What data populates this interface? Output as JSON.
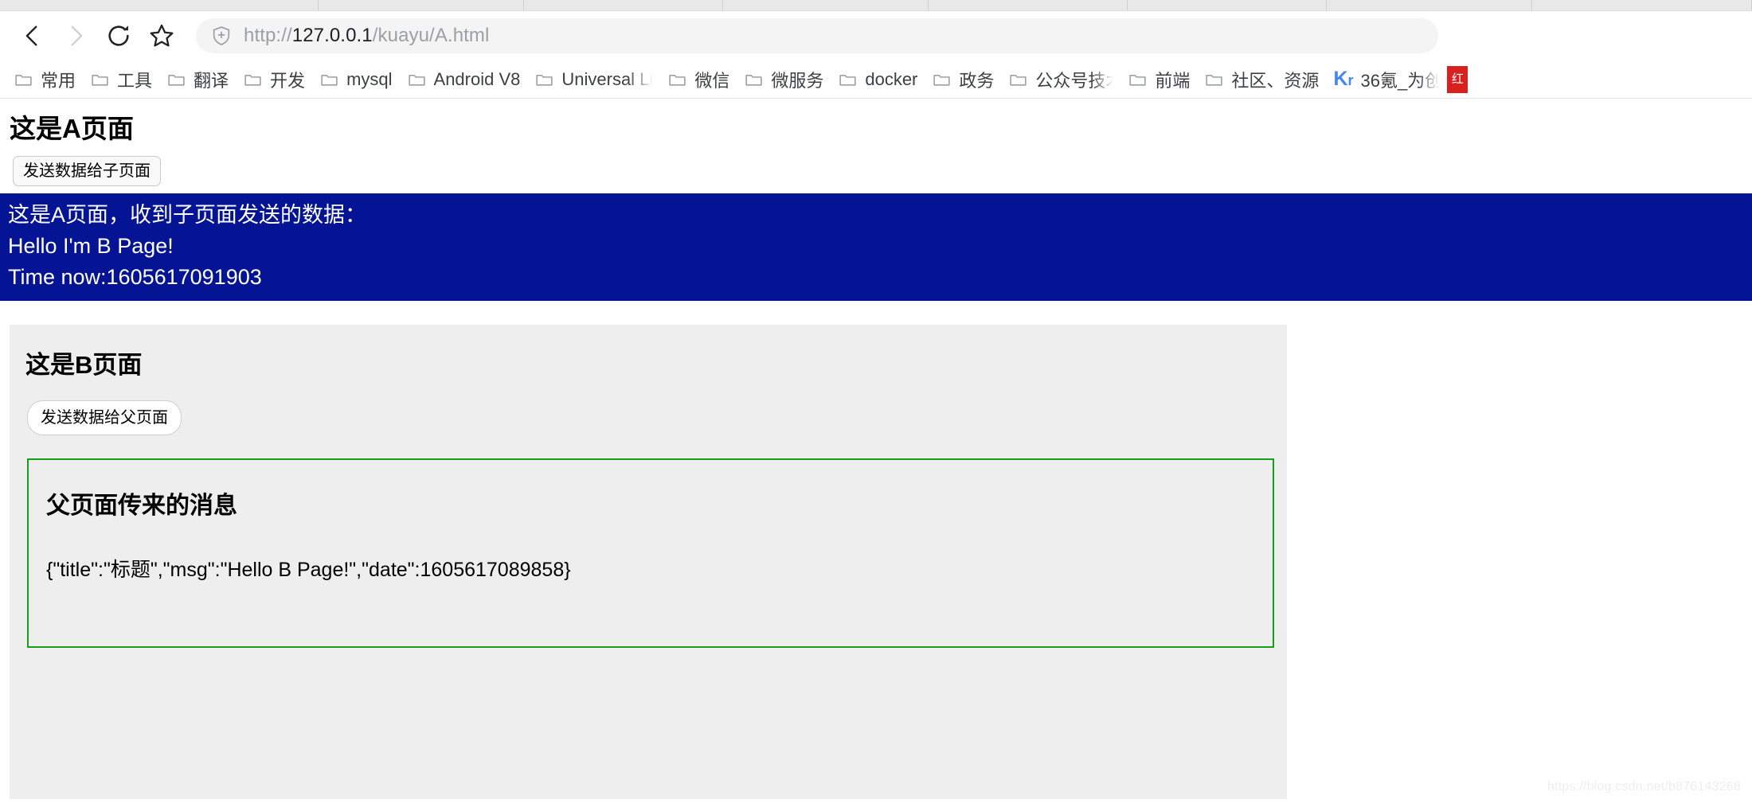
{
  "browser": {
    "nav": {
      "back_label": "Back",
      "forward_label": "Forward",
      "reload_label": "Reload",
      "bookmark_label": "Bookmark this page"
    },
    "omnibox": {
      "security_icon": "shield-plus-icon",
      "url_scheme": "http://",
      "url_host": "127.0.0.1",
      "url_path": "/kuayu/A.html",
      "url_full": "http://127.0.0.1/kuayu/A.html"
    },
    "bookmarks": [
      {
        "label": "常用",
        "icon": "folder-icon",
        "truncated": false
      },
      {
        "label": "工具",
        "icon": "folder-icon",
        "truncated": false
      },
      {
        "label": "翻译",
        "icon": "folder-icon",
        "truncated": false
      },
      {
        "label": "开发",
        "icon": "folder-icon",
        "truncated": false
      },
      {
        "label": "mysql",
        "icon": "folder-icon",
        "truncated": false
      },
      {
        "label": "Android V8",
        "icon": "folder-icon",
        "truncated": false
      },
      {
        "label": "Universal Li",
        "icon": "folder-icon",
        "truncated": true
      },
      {
        "label": "微信",
        "icon": "folder-icon",
        "truncated": false
      },
      {
        "label": "微服务",
        "icon": "folder-icon",
        "truncated": false
      },
      {
        "label": "docker",
        "icon": "folder-icon",
        "truncated": false
      },
      {
        "label": "政务",
        "icon": "folder-icon",
        "truncated": false
      },
      {
        "label": "公众号技术",
        "icon": "folder-icon",
        "truncated": true
      },
      {
        "label": "前端",
        "icon": "folder-icon",
        "truncated": false
      },
      {
        "label": "社区、资源",
        "icon": "folder-icon",
        "truncated": false
      },
      {
        "label": "36氪_为创",
        "icon": "kr-logo-icon",
        "truncated": true
      }
    ],
    "overflow_badge": "红"
  },
  "page_a": {
    "title": "这是A页面",
    "send_button_label": "发送数据给子页面",
    "received_box": {
      "accent_color": "#051494",
      "text_color": "#ffffff",
      "lines": [
        "这是A页面，收到子页面发送的数据：",
        "Hello I'm B Page!",
        "Time now:1605617091903"
      ]
    }
  },
  "page_b": {
    "title": "这是B页面",
    "send_button_label": "发送数据给父页面",
    "message_box": {
      "border_color": "#179c1b",
      "heading": "父页面传来的消息",
      "payload": "{\"title\":\"标题\",\"msg\":\"Hello B Page!\",\"date\":1605617089858}"
    }
  },
  "watermark": "https://blog.csdn.net/b876143268"
}
